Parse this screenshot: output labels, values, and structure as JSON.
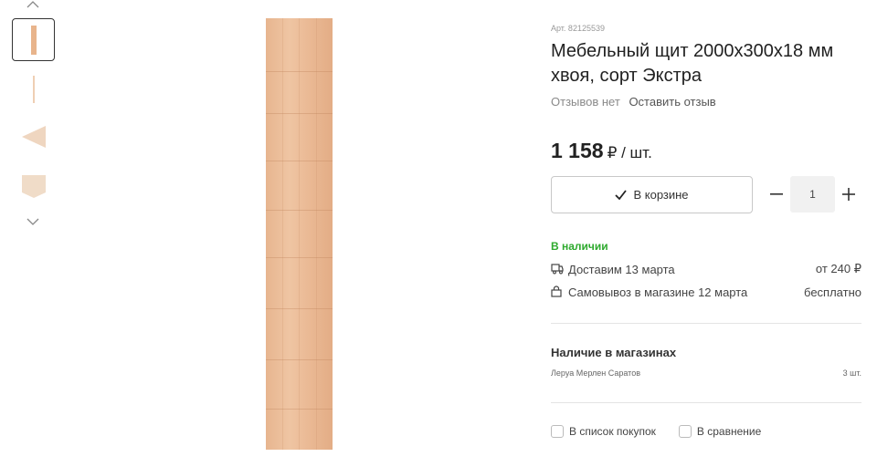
{
  "gallery": {
    "thumbnails": [
      "plank-front",
      "plank-side",
      "plank-edge",
      "plank-end"
    ],
    "active_index": 0
  },
  "product": {
    "article": "Арт. 82125539",
    "title": "Мебельный щит 2000x300x18 мм хвоя, сорт Экстра",
    "reviews": {
      "none_label": "Отзывов нет",
      "leave_label": "Оставить отзыв"
    },
    "price": {
      "amount": "1 158",
      "unit": "₽ / шт."
    }
  },
  "cart": {
    "button_label": "В корзине",
    "quantity": "1"
  },
  "availability": {
    "status": "В наличии",
    "status_color": "#2eaa2e",
    "delivery": {
      "label": "Доставим 13 марта",
      "value": "от 240 ₽",
      "icon": "truck-icon"
    },
    "pickup": {
      "label": "Самовывоз в магазине 12 марта",
      "value": "бесплатно",
      "icon": "bag-icon"
    }
  },
  "stores": {
    "title": "Наличие в магазинах",
    "items": [
      {
        "name": "Леруа Мерлен Саратов",
        "count": "3 шт."
      }
    ]
  },
  "actions": {
    "shopping_list_label": "В список покупок",
    "compare_label": "В сравнение"
  }
}
